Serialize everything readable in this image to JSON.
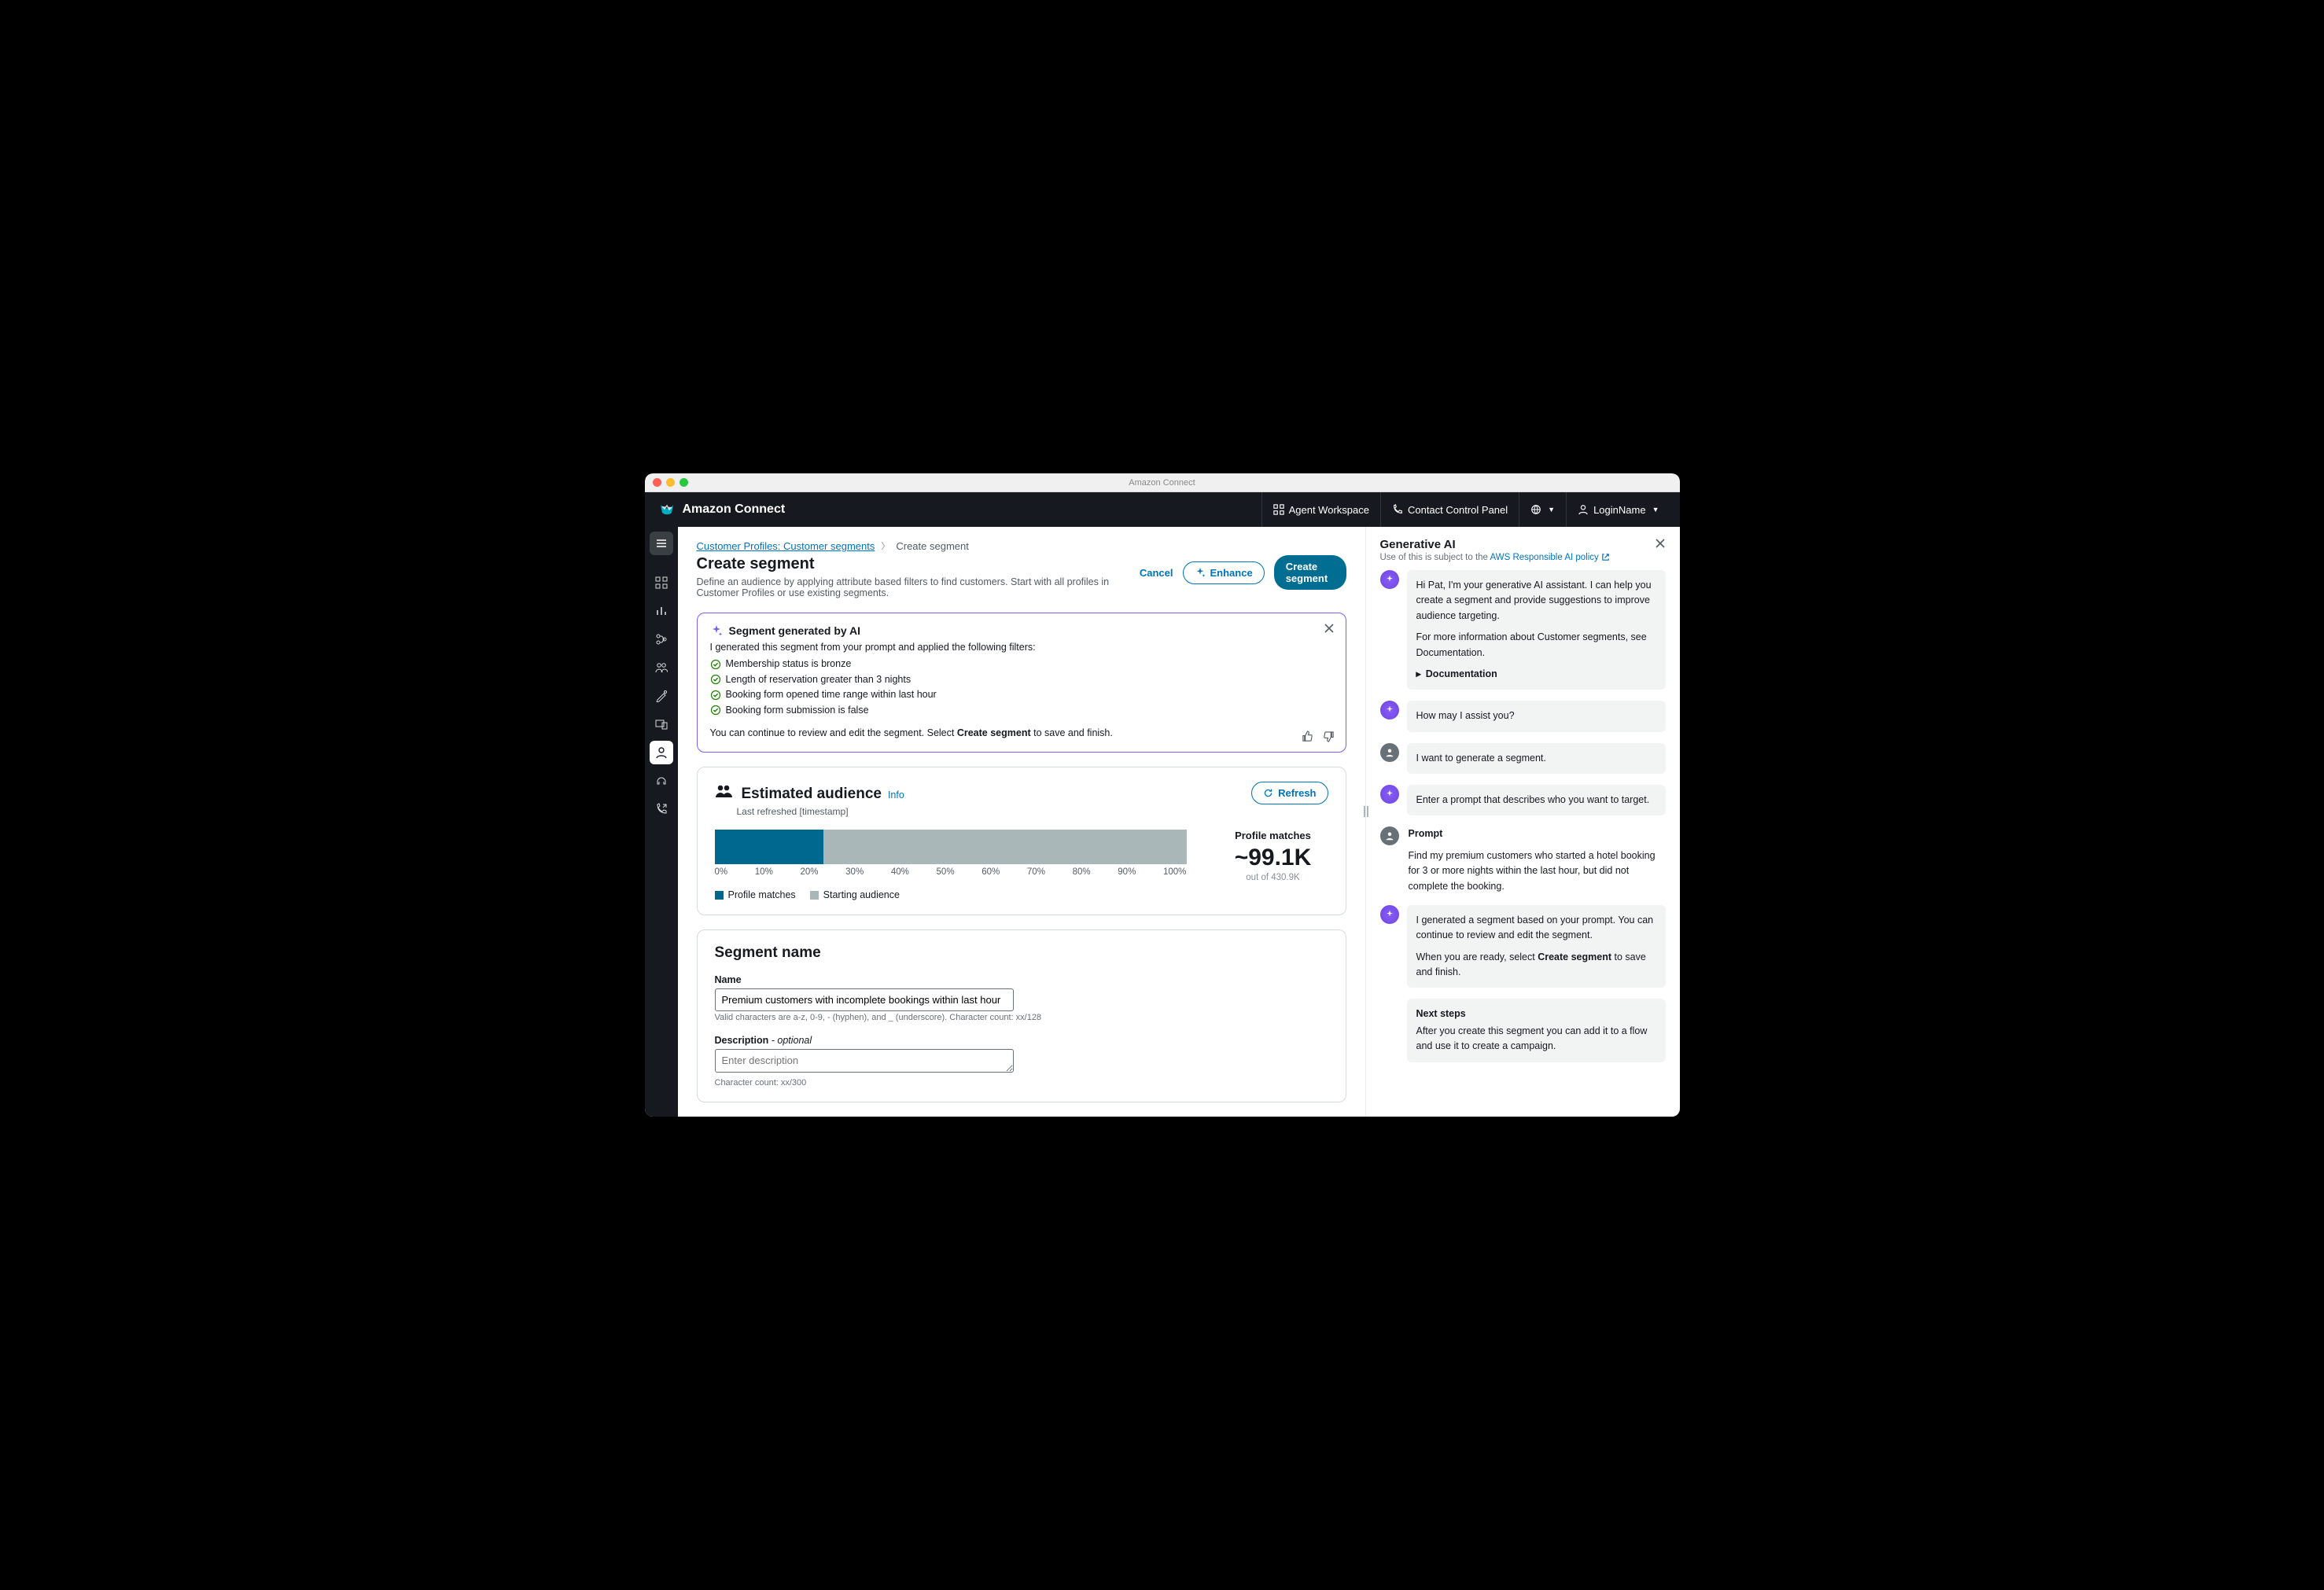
{
  "mac": {
    "title": "Amazon Connect"
  },
  "topbar": {
    "logo_text": "Amazon Connect",
    "agent_workspace": "Agent Workspace",
    "contact_panel": "Contact Control Panel",
    "login_name": "LoginName"
  },
  "breadcrumb": {
    "root": "Customer Profiles: Customer segments",
    "current": "Create segment"
  },
  "header": {
    "title": "Create segment",
    "subtitle": "Define an audience by applying attribute based filters to find customers. Start with all profiles in Customer Profiles or use existing segments.",
    "cancel": "Cancel",
    "enhance": "Enhance",
    "create": "Create segment"
  },
  "ai_box": {
    "title": "Segment generated by AI",
    "intro": "I generated this segment from your prompt and applied the following filters:",
    "filters": [
      "Membership status is bronze",
      "Length of reservation greater than 3 nights",
      "Booking form opened time range within last hour",
      "Booking form submission is false"
    ],
    "continue_pre": "You can continue to review and edit the segment. Select ",
    "continue_bold": "Create segment",
    "continue_post": " to save and finish."
  },
  "audience": {
    "title": "Estimated audience",
    "info": "Info",
    "refresh": "Refresh",
    "last_refreshed": "Last refreshed [timestamp]",
    "match_label": "Profile matches",
    "match_value": "~99.1K",
    "match_sub": "out of 430.9K",
    "legend_matches": "Profile matches",
    "legend_starting": "Starting audience"
  },
  "segment_name": {
    "section_title": "Segment name",
    "name_label": "Name",
    "name_value": "Premium customers with incomplete bookings within last hour",
    "name_hint": "Valid characters are a-z, 0-9, - (hyphen), and _ (underscore). Character count: xx/128",
    "desc_label": "Description",
    "desc_optional": " - optional",
    "desc_placeholder": "Enter description",
    "desc_hint": "Character count: xx/300"
  },
  "ai_panel": {
    "title": "Generative AI",
    "policy_pre": "Use of this is subject to the  ",
    "policy_link": "AWS Responsible AI policy",
    "documentation_label": "Documentation",
    "messages": {
      "intro_p1": "Hi Pat, I'm your generative AI assistant. I can help you create a segment and provide suggestions to improve audience targeting.",
      "intro_p2": "For more information about Customer segments, see Documentation.",
      "assist": "How may I assist you?",
      "user1": "I want to generate a segment.",
      "prompt_instruction": "Enter a prompt that describes who you want to target.",
      "prompt_label": "Prompt",
      "prompt_text": "Find my premium customers who started a hotel booking for 3 or more nights within the last hour, but did not complete the booking.",
      "result_p1": "I generated a segment based on your prompt. You can continue to review and edit the segment.",
      "result_p2_pre": "When you are ready, select ",
      "result_p2_bold": "Create segment",
      "result_p2_post": " to save and  finish.",
      "next_title": "Next steps",
      "next_body": "After you create this segment you can add it to a flow and use it to create a campaign."
    }
  },
  "chart_data": {
    "type": "bar",
    "title": "Estimated audience",
    "xlabel": "",
    "ylabel": "",
    "categories": [
      "0%",
      "10%",
      "20%",
      "30%",
      "40%",
      "50%",
      "60%",
      "70%",
      "80%",
      "90%",
      "100%"
    ],
    "series": [
      {
        "name": "Profile matches",
        "percent": 23,
        "count": 99100
      },
      {
        "name": "Starting audience",
        "percent": 100,
        "count": 430900
      }
    ],
    "xlim": [
      0,
      100
    ]
  }
}
